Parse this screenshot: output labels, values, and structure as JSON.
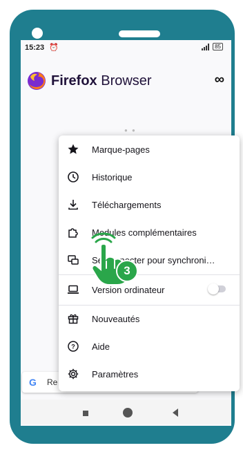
{
  "status": {
    "time": "15:23",
    "alarm_icon": "alarm-icon",
    "battery": "85"
  },
  "brand": {
    "bold": "Firefox",
    "rest": " Browser"
  },
  "header": {
    "more_icon": "infinity-icon"
  },
  "search": {
    "prefix": "Re",
    "logo": "G"
  },
  "menu": {
    "items": [
      {
        "label": "Marque-pages",
        "icon": "star-icon"
      },
      {
        "label": "Historique",
        "icon": "clock-icon"
      },
      {
        "label": "Téléchargements",
        "icon": "download-icon"
      },
      {
        "label": "Modules complémentaires",
        "icon": "puzzle-icon"
      },
      {
        "label": "Se connecter pour synchroni…",
        "icon": "sync-account-icon"
      },
      {
        "label": "Version ordinateur",
        "icon": "laptop-icon"
      },
      {
        "label": "Nouveautés",
        "icon": "gift-icon"
      },
      {
        "label": "Aide",
        "icon": "help-icon"
      },
      {
        "label": "Paramètres",
        "icon": "gear-icon"
      }
    ],
    "desktop_toggle": false
  },
  "annotation": {
    "step": "3"
  },
  "colors": {
    "phone_frame": "#1f7e8f",
    "step_badge": "#2aa64a"
  }
}
